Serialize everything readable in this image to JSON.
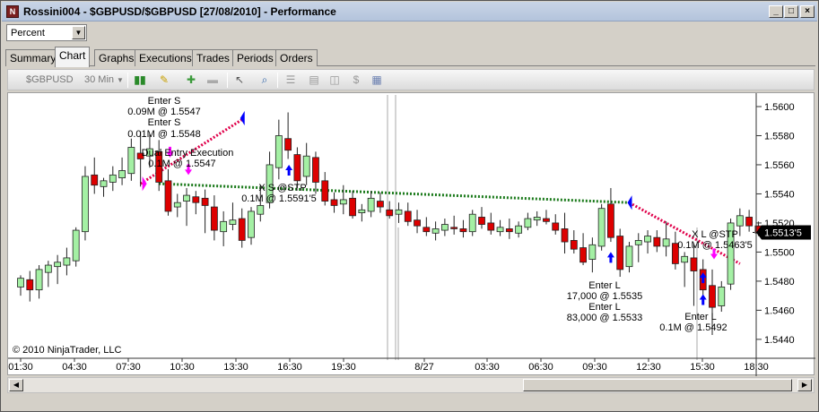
{
  "window": {
    "title": "Rossini004 - $GBPUSD/$GBPUSD [27/08/2010] - Performance",
    "app_icon": "ninjatrader-icon",
    "controls": [
      "minimize-icon",
      "maximize-icon",
      "close-icon"
    ]
  },
  "view_select": {
    "value": "Percent"
  },
  "tabs": [
    {
      "label": "Summary"
    },
    {
      "label": "Chart"
    },
    {
      "label": "Graphs"
    },
    {
      "label": "Executions"
    },
    {
      "label": "Trades"
    },
    {
      "label": "Periods"
    },
    {
      "label": "Orders"
    }
  ],
  "active_tab": "Chart",
  "toolbar": {
    "instrument": "$GBPUSD",
    "interval": "30 Min",
    "icons": [
      "chart-style-icon",
      "drawing-pencil-icon",
      "zoom-in-icon",
      "zoom-out-icon",
      "cursor-icon",
      "magnifier-icon",
      "properties-icon",
      "data-box-icon",
      "indicators-icon",
      "strategies-icon",
      "notes-icon"
    ]
  },
  "chart": {
    "copyright": "© 2010 NinjaTrader, LLC",
    "current_price": "1.5513'5",
    "y_ticks": [
      "1.5600",
      "1.5580",
      "1.5560",
      "1.5540",
      "1.5520",
      "1.5500",
      "1.5480",
      "1.5460",
      "1.5440"
    ],
    "x_ticks": [
      "01:30",
      "04:30",
      "07:30",
      "10:30",
      "13:30",
      "16:30",
      "19:30",
      "8/27",
      "03:30",
      "06:30",
      "09:30",
      "12:30",
      "15:30",
      "18:30"
    ],
    "annotations": {
      "enter_s_1a": "Enter S",
      "enter_s_1b": "0.09M @ 1.5547",
      "enter_s_2a": "Enter S",
      "enter_s_2b": "0.01M @ 1.5548",
      "dual_entry_a": "Dual Entry Execution",
      "dual_entry_b": "0.1M @ 1.5547",
      "xs_a": "X S @STP",
      "xs_b": "0.1M @ 1.5591'5",
      "enter_l_1a": "Enter L",
      "enter_l_1b": "17,000 @ 1.5535",
      "enter_l_2a": "Enter L",
      "enter_l_2b": "83,000 @ 1.5533",
      "xl_a": "X L @STP",
      "xl_b": "0.1M @ 1.5463'5",
      "enter_l_3a": "Enter L",
      "enter_l_3b": "0.1M @ 1.5492"
    }
  },
  "chart_data": {
    "type": "candlestick",
    "instrument": "$GBPUSD",
    "interval": "30 Min",
    "ylim": [
      1.5435,
      1.5608
    ],
    "candles": [
      [
        1.5476,
        1.5484,
        1.547,
        1.5482
      ],
      [
        1.5481,
        1.5487,
        1.5466,
        1.5474
      ],
      [
        1.5474,
        1.5491,
        1.5468,
        1.5488
      ],
      [
        1.5486,
        1.5494,
        1.5476,
        1.5491
      ],
      [
        1.549,
        1.5498,
        1.5478,
        1.5493
      ],
      [
        1.5491,
        1.5503,
        1.5484,
        1.5496
      ],
      [
        1.5494,
        1.5517,
        1.549,
        1.5515
      ],
      [
        1.5514,
        1.5559,
        1.5508,
        1.5552
      ],
      [
        1.5553,
        1.5565,
        1.554,
        1.5546
      ],
      [
        1.5545,
        1.5551,
        1.5538,
        1.5549
      ],
      [
        1.5548,
        1.5559,
        1.5542,
        1.5553
      ],
      [
        1.5551,
        1.5565,
        1.5546,
        1.5556
      ],
      [
        1.5554,
        1.5578,
        1.5549,
        1.5572
      ],
      [
        1.5568,
        1.5583,
        1.5545,
        1.5564
      ],
      [
        1.5566,
        1.5581,
        1.5558,
        1.5571
      ],
      [
        1.5569,
        1.5577,
        1.5542,
        1.5548
      ],
      [
        1.5549,
        1.5557,
        1.5525,
        1.5528
      ],
      [
        1.5531,
        1.554,
        1.5524,
        1.5534
      ],
      [
        1.5535,
        1.5544,
        1.5518,
        1.5539
      ],
      [
        1.5538,
        1.5542,
        1.5526,
        1.5534
      ],
      [
        1.5537,
        1.5543,
        1.5513,
        1.5532
      ],
      [
        1.5531,
        1.5539,
        1.5508,
        1.5515
      ],
      [
        1.5514,
        1.5528,
        1.5504,
        1.5521
      ],
      [
        1.5519,
        1.5534,
        1.5515,
        1.5522
      ],
      [
        1.5523,
        1.553,
        1.5503,
        1.5508
      ],
      [
        1.551,
        1.5531,
        1.5505,
        1.5528
      ],
      [
        1.5526,
        1.5546,
        1.5521,
        1.5532
      ],
      [
        1.5534,
        1.5569,
        1.553,
        1.556
      ],
      [
        1.5558,
        1.5591,
        1.555,
        1.558
      ],
      [
        1.5578,
        1.5596,
        1.5564,
        1.557
      ],
      [
        1.5567,
        1.5572,
        1.5544,
        1.5549
      ],
      [
        1.5552,
        1.5575,
        1.5546,
        1.5566
      ],
      [
        1.5565,
        1.5569,
        1.554,
        1.5548
      ],
      [
        1.5549,
        1.5555,
        1.5532,
        1.5535
      ],
      [
        1.5536,
        1.5541,
        1.5527,
        1.5532
      ],
      [
        1.5533,
        1.5546,
        1.5526,
        1.5536
      ],
      [
        1.5537,
        1.5542,
        1.5523,
        1.5525
      ],
      [
        1.5527,
        1.5533,
        1.5521,
        1.5529
      ],
      [
        1.5528,
        1.5542,
        1.5524,
        1.5537
      ],
      [
        1.5535,
        1.5541,
        1.5527,
        1.5531
      ],
      [
        1.5529,
        1.5535,
        1.5523,
        1.5525
      ],
      [
        1.5526,
        1.5534,
        1.552,
        1.5529
      ],
      [
        1.5528,
        1.5534,
        1.5518,
        1.5521
      ],
      [
        1.5522,
        1.5529,
        1.5513,
        1.5518
      ],
      [
        1.5517,
        1.5524,
        1.5511,
        1.5514
      ],
      [
        1.5513,
        1.5521,
        1.5508,
        1.5516
      ],
      [
        1.5515,
        1.5523,
        1.5511,
        1.5519
      ],
      [
        1.5517,
        1.5525,
        1.5512,
        1.5516
      ],
      [
        1.5516,
        1.5522,
        1.551,
        1.5514
      ],
      [
        1.5514,
        1.5529,
        1.5511,
        1.5526
      ],
      [
        1.5524,
        1.5531,
        1.5516,
        1.5519
      ],
      [
        1.552,
        1.5527,
        1.5512,
        1.5515
      ],
      [
        1.5514,
        1.5522,
        1.5511,
        1.5517
      ],
      [
        1.5516,
        1.5523,
        1.5509,
        1.5514
      ],
      [
        1.5513,
        1.5521,
        1.551,
        1.5518
      ],
      [
        1.5517,
        1.5527,
        1.5515,
        1.5523
      ],
      [
        1.5522,
        1.5528,
        1.5518,
        1.5524
      ],
      [
        1.5523,
        1.5529,
        1.5519,
        1.5521
      ],
      [
        1.552,
        1.5526,
        1.5512,
        1.5515
      ],
      [
        1.5516,
        1.5527,
        1.5499,
        1.5507
      ],
      [
        1.5508,
        1.5515,
        1.5499,
        1.5502
      ],
      [
        1.5503,
        1.5513,
        1.5491,
        1.5493
      ],
      [
        1.5495,
        1.551,
        1.5486,
        1.5505
      ],
      [
        1.5504,
        1.5533,
        1.5501,
        1.553
      ],
      [
        1.5533,
        1.5544,
        1.5507,
        1.551
      ],
      [
        1.5511,
        1.5516,
        1.5483,
        1.5488
      ],
      [
        1.549,
        1.5507,
        1.5486,
        1.5504
      ],
      [
        1.5505,
        1.5513,
        1.5493,
        1.5508
      ],
      [
        1.5507,
        1.5515,
        1.5499,
        1.5511
      ],
      [
        1.551,
        1.5515,
        1.55,
        1.5504
      ],
      [
        1.5504,
        1.5521,
        1.5497,
        1.5509
      ],
      [
        1.5506,
        1.5514,
        1.5488,
        1.5492
      ],
      [
        1.5493,
        1.55,
        1.5476,
        1.5497
      ],
      [
        1.5496,
        1.5505,
        1.5463,
        1.5487
      ],
      [
        1.5488,
        1.5495,
        1.5467,
        1.5474
      ],
      [
        1.5477,
        1.5488,
        1.5443,
        1.5462
      ],
      [
        1.5463,
        1.548,
        1.5459,
        1.5476
      ],
      [
        1.5478,
        1.5523,
        1.5474,
        1.552
      ],
      [
        1.5518,
        1.553,
        1.5511,
        1.5525
      ],
      [
        1.5524,
        1.5529,
        1.5514,
        1.5518
      ],
      [
        1.5518,
        1.5521,
        1.5511,
        1.5513
      ]
    ],
    "trade_lines": [
      {
        "from_bar": 13,
        "from_price": 1.5547,
        "to_bar": 24,
        "to_price": 1.5591,
        "color": "#e0004a"
      },
      {
        "from_bar": 15,
        "from_price": 1.5547,
        "to_bar": 66,
        "to_price": 1.5534,
        "color": "#1b7a1b"
      },
      {
        "from_bar": 66,
        "from_price": 1.5534,
        "to_bar": 78,
        "to_price": 1.5492,
        "color": "#e0004a"
      }
    ],
    "colors": {
      "up": "#a4f0a4",
      "down": "#dd0000",
      "outline": "#222222",
      "background": "#ffffff"
    }
  }
}
